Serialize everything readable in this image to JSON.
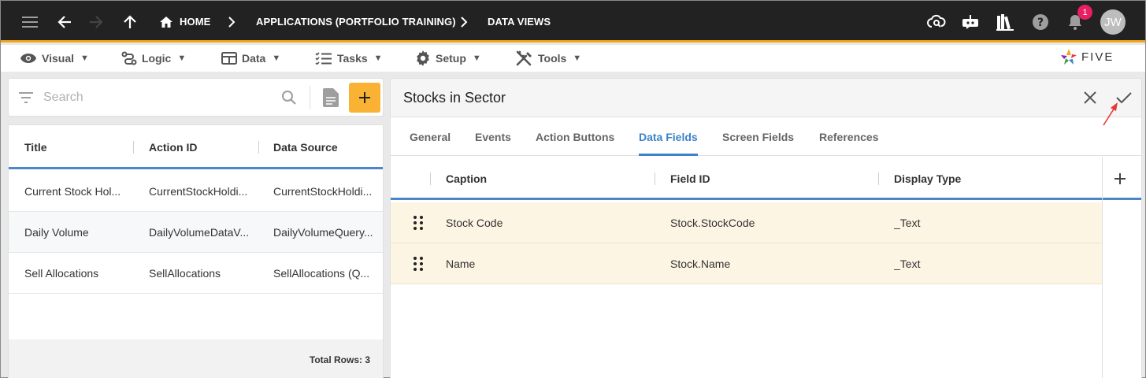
{
  "topbar": {
    "breadcrumbs": [
      "HOME",
      "APPLICATIONS (PORTFOLIO TRAINING)",
      "DATA VIEWS"
    ],
    "notification_count": "1",
    "avatar_initials": "JW",
    "icons": [
      "menu-icon",
      "back-arrow-icon",
      "forward-arrow-icon",
      "up-arrow-icon",
      "home-icon",
      "chevron-right-icon",
      "cloud-search-icon",
      "chatbot-icon",
      "library-icon",
      "help-icon",
      "bell-icon"
    ]
  },
  "menubar": {
    "items": [
      {
        "label": "Visual",
        "icon": "eye-icon"
      },
      {
        "label": "Logic",
        "icon": "logic-icon"
      },
      {
        "label": "Data",
        "icon": "table-icon"
      },
      {
        "label": "Tasks",
        "icon": "tasks-icon"
      },
      {
        "label": "Setup",
        "icon": "gear-icon"
      },
      {
        "label": "Tools",
        "icon": "tools-icon"
      }
    ],
    "logo_text": "FIVE"
  },
  "left": {
    "search_placeholder": "Search",
    "columns": [
      "Title",
      "Action ID",
      "Data Source"
    ],
    "rows": [
      [
        "Current Stock Hol...",
        "CurrentStockHoldi...",
        "CurrentStockHoldi..."
      ],
      [
        "Daily Volume",
        "DailyVolumeDataV...",
        "DailyVolumeQuery..."
      ],
      [
        "Sell Allocations",
        "SellAllocations",
        "SellAllocations (Q..."
      ]
    ],
    "total_rows": "Total Rows: 3"
  },
  "form": {
    "title": "Stocks in Sector",
    "tabs": [
      "General",
      "Events",
      "Action Buttons",
      "Data Fields",
      "Screen Fields",
      "References"
    ],
    "active_tab": "Data Fields",
    "grid_columns": [
      "Caption",
      "Field ID",
      "Display Type"
    ],
    "grid_rows": [
      [
        "Stock Code",
        "Stock.StockCode",
        "_Text"
      ],
      [
        "Name",
        "Stock.Name",
        "_Text"
      ]
    ]
  },
  "colors": {
    "topbar_bg": "#222222",
    "accent_orange": "#f4a71d",
    "add_button": "#f9b233",
    "active_tab": "#3c82c8",
    "row_highlight": "#fdf5e4",
    "badge": "#e91e63",
    "annotation_arrow": "#e53935"
  }
}
